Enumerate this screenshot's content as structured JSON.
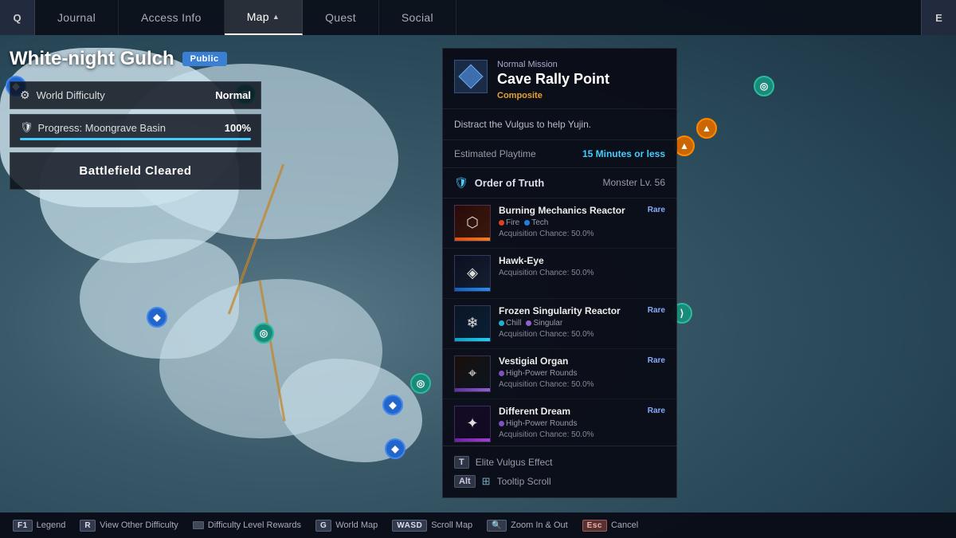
{
  "nav": {
    "left_key": "Q",
    "right_key": "E",
    "tabs": [
      {
        "id": "journal",
        "label": "Journal",
        "active": false
      },
      {
        "id": "access-info",
        "label": "Access Info",
        "active": false
      },
      {
        "id": "map",
        "label": "Map",
        "active": true
      },
      {
        "id": "quest",
        "label": "Quest",
        "active": false
      },
      {
        "id": "social",
        "label": "Social",
        "active": false
      }
    ]
  },
  "left_panel": {
    "location_name": "White-night Gulch",
    "public_badge": "Public",
    "difficulty_label": "World Difficulty",
    "difficulty_value": "Normal",
    "progress_label": "Progress: Moongrave Basin",
    "progress_pct": "100%",
    "progress_fill": 100,
    "cleared_label": "Battlefield Cleared"
  },
  "mission": {
    "type": "Normal Mission",
    "name": "Cave Rally Point",
    "composite_label": "Composite",
    "description": "Distract the Vulgus to help Yujin.",
    "playtime_label": "Estimated Playtime",
    "playtime_value": "15 Minutes or less",
    "order_icon": "🛡",
    "order_name": "Order of Truth",
    "order_level": "Monster Lv. 56",
    "items": [
      {
        "name": "Burning Mechanics Reactor",
        "rarity": "Rare",
        "type": "fire-tech",
        "tags": [
          {
            "dot": "dot-fire",
            "label": "Fire"
          },
          {
            "dot": "dot-tech",
            "label": "Tech"
          }
        ],
        "chance": "Acquisition Chance: 50.0%",
        "bar": "orange",
        "icon": "⬡"
      },
      {
        "name": "Hawk-Eye",
        "rarity": "",
        "type": "hawk",
        "tags": [],
        "chance": "Acquisition Chance: 50.0%",
        "bar": "blue",
        "icon": "◈"
      },
      {
        "name": "Frozen Singularity Reactor",
        "rarity": "Rare",
        "type": "chill",
        "tags": [
          {
            "dot": "dot-chill",
            "label": "Chill"
          },
          {
            "dot": "dot-singular",
            "label": "Singular"
          }
        ],
        "chance": "Acquisition Chance: 50.0%",
        "bar": "cyan",
        "icon": "❄"
      },
      {
        "name": "Vestigial Organ",
        "rarity": "Rare",
        "type": "vestigial",
        "tags": [
          {
            "dot": "dot-rounds",
            "label": "High-Power Rounds"
          }
        ],
        "chance": "Acquisition Chance: 50.0%",
        "bar": "purple",
        "icon": "⌖"
      },
      {
        "name": "Different Dream",
        "rarity": "Rare",
        "type": "dream",
        "tags": [
          {
            "dot": "dot-rounds",
            "label": "High-Power Rounds"
          }
        ],
        "chance": "Acquisition Chance: 50.0%",
        "bar": "violet",
        "icon": "✦"
      }
    ]
  },
  "footer": {
    "elite_key": "T",
    "elite_label": "Elite Vulgus Effect",
    "scroll_key": "Alt",
    "scroll_icon": "⊞",
    "scroll_label": "Tooltip Scroll"
  },
  "bottom_bar": [
    {
      "key": "F1",
      "label": "Legend"
    },
    {
      "key": "R",
      "label": "View Other Difficulty"
    },
    {
      "key": "diff",
      "label": "Difficulty Level Rewards"
    },
    {
      "key": "G",
      "label": "World Map"
    },
    {
      "key": "WASD",
      "label": "Scroll Map"
    },
    {
      "key": "🔍",
      "label": "Zoom In & Out"
    },
    {
      "key": "Esc",
      "label": "Cancel"
    }
  ]
}
